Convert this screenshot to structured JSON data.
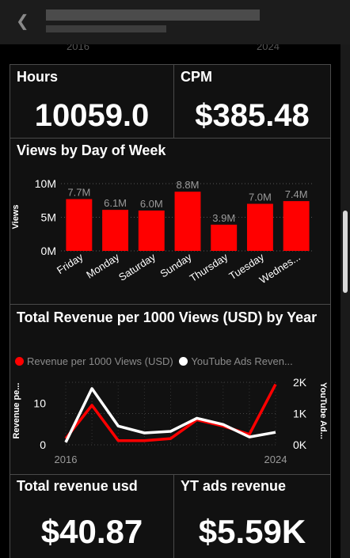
{
  "header": {
    "back_icon": "chevron-left-icon"
  },
  "peek_axis": {
    "start": "2016",
    "end": "2024"
  },
  "hours": {
    "title": "Hours",
    "value": "10059.0"
  },
  "cpm": {
    "title": "CPM",
    "value": "$385.48"
  },
  "views_chart": {
    "title": "Views by Day of Week",
    "chart_data": {
      "type": "bar",
      "title": "Views by Day of Week",
      "ylabel": "Views",
      "xlabel": "",
      "categories": [
        "Friday",
        "Monday",
        "Saturday",
        "Sunday",
        "Thursday",
        "Tuesday",
        "Wednes..."
      ],
      "values": [
        7.7,
        6.1,
        6.0,
        8.8,
        3.9,
        7.0,
        7.4
      ],
      "value_labels": [
        "7.7M",
        "6.1M",
        "6.0M",
        "8.8M",
        "3.9M",
        "7.0M",
        "7.4M"
      ],
      "unit": "M",
      "ylim": [
        0,
        10
      ],
      "yticks": [
        "0M",
        "5M",
        "10M"
      ],
      "color": "#ff0000",
      "grid": true
    }
  },
  "revenue_chart": {
    "title": "Total Revenue per 1000 Views (USD) by Year",
    "legend": [
      "Revenue per 1000 Views (USD)",
      "YouTube Ads Reven..."
    ],
    "chart_data": {
      "type": "line",
      "title": "Total Revenue per 1000 Views (USD) by Year",
      "ylabel": "Revenue pe...",
      "y2label": "YouTube Ad...",
      "x": [
        2016,
        2017,
        2018,
        2019,
        2020,
        2021,
        2022,
        2023,
        2024
      ],
      "xticks": [
        "2016",
        "2024"
      ],
      "ylim": [
        0,
        15
      ],
      "yticks": [
        "0",
        "10"
      ],
      "y2lim": [
        0,
        2000
      ],
      "y2ticks": [
        "0K",
        "1K",
        "2K"
      ],
      "series": [
        {
          "name": "Revenue per 1000 Views (USD)",
          "color": "#ff0000",
          "values": [
            1.5,
            9.5,
            1.0,
            1.0,
            1.5,
            6.0,
            4.5,
            2.5,
            14.5
          ],
          "axis": "left"
        },
        {
          "name": "YouTube Ads Reven...",
          "color": "#ffffff",
          "values": [
            80,
            1800,
            600,
            380,
            430,
            850,
            650,
            250,
            400
          ],
          "axis": "right"
        }
      ],
      "grid": true,
      "legend_position": "top"
    }
  },
  "total_revenue": {
    "title": "Total revenue usd",
    "value": "$40.87"
  },
  "yt_ads": {
    "title": "YT ads revenue",
    "value": "$5.59K"
  }
}
